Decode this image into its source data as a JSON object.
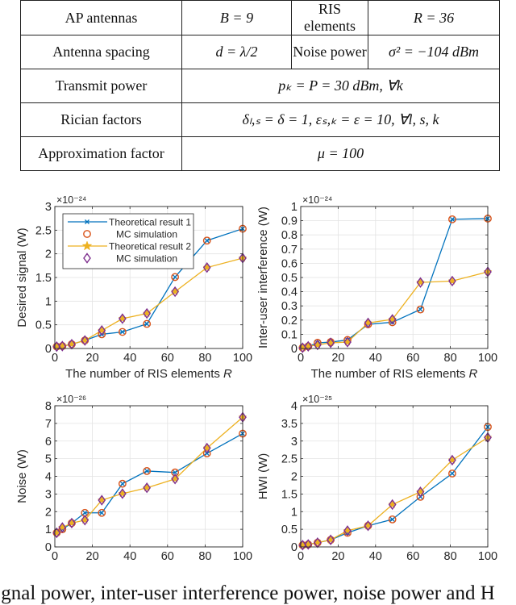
{
  "table": {
    "rows": [
      {
        "cells": [
          "AP antennas",
          "B = 9",
          "RIS elements",
          "R = 36"
        ]
      },
      {
        "cells": [
          "Antenna spacing",
          "d = λ/2",
          "Noise power",
          "σ² = −104 dBm"
        ]
      },
      {
        "cells": [
          "Transmit power",
          "pₖ = P = 30 dBm, ∀k"
        ]
      },
      {
        "cells": [
          "Rician factors",
          "δₗ,ₛ = δ = 1, εₛ,ₖ = ε = 10, ∀l, s, k"
        ]
      },
      {
        "cells": [
          "Approximation factor",
          "μ = 100"
        ]
      }
    ]
  },
  "caption": "gnal power, inter-user interference power, noise power and H",
  "colors": {
    "series1": "#0072BD",
    "mc1": "#D95319",
    "series2": "#EDB120",
    "mc2": "#7E2F8E"
  },
  "chart_data": [
    {
      "type": "line",
      "title": "",
      "xlabel": "The number of RIS elements R",
      "ylabel": "Desired signal (W)",
      "exponent": "×10⁻²⁴",
      "xlim": [
        0,
        100
      ],
      "ylim": [
        0,
        3
      ],
      "xticks": [
        0,
        20,
        40,
        60,
        80,
        100
      ],
      "yticks": [
        0,
        0.5,
        1,
        1.5,
        2,
        2.5,
        3
      ],
      "ytick_labels": [
        "0",
        "0.5",
        "1",
        "1.5",
        "2",
        "2.5",
        "3"
      ],
      "grid": true,
      "legend": {
        "placement": "top-left",
        "entries": [
          "Theoretical result 1",
          "MC simulation",
          "Theoretical result 2",
          "MC simulation"
        ]
      },
      "x": [
        1,
        4,
        9,
        16,
        25,
        36,
        49,
        64,
        81,
        100
      ],
      "series": [
        {
          "name": "Theoretical result 1",
          "values": [
            0.04,
            0.05,
            0.09,
            0.17,
            0.3,
            0.35,
            0.52,
            1.51,
            2.28,
            2.53
          ]
        },
        {
          "name": "MC simulation (1)",
          "values": [
            0.04,
            0.05,
            0.09,
            0.17,
            0.3,
            0.35,
            0.52,
            1.51,
            2.28,
            2.53
          ]
        },
        {
          "name": "Theoretical result 2",
          "values": [
            0.04,
            0.05,
            0.09,
            0.17,
            0.38,
            0.63,
            0.74,
            1.2,
            1.71,
            1.91
          ]
        },
        {
          "name": "MC simulation (2)",
          "values": [
            0.04,
            0.05,
            0.09,
            0.17,
            0.38,
            0.63,
            0.74,
            1.2,
            1.71,
            1.91
          ]
        }
      ]
    },
    {
      "type": "line",
      "title": "",
      "xlabel": "The number of RIS elements R",
      "ylabel": "Inter-user interference (W)",
      "exponent": "×10⁻²⁴",
      "xlim": [
        0,
        100
      ],
      "ylim": [
        0,
        1
      ],
      "xticks": [
        0,
        20,
        40,
        60,
        80,
        100
      ],
      "yticks": [
        0,
        0.1,
        0.2,
        0.3,
        0.4,
        0.5,
        0.6,
        0.7,
        0.8,
        0.9,
        1
      ],
      "ytick_labels": [
        "0",
        "0.1",
        "0.2",
        "0.3",
        "0.4",
        "0.5",
        "0.6",
        "0.7",
        "0.8",
        "0.9",
        "1"
      ],
      "grid": true,
      "x": [
        1,
        4,
        9,
        16,
        25,
        36,
        49,
        64,
        81,
        100
      ],
      "series": [
        {
          "name": "Theoretical result 1",
          "values": [
            0.005,
            0.015,
            0.04,
            0.045,
            0.06,
            0.17,
            0.185,
            0.275,
            0.91,
            0.915
          ]
        },
        {
          "name": "MC simulation (1)",
          "values": [
            0.005,
            0.015,
            0.04,
            0.045,
            0.06,
            0.17,
            0.185,
            0.275,
            0.91,
            0.915
          ]
        },
        {
          "name": "Theoretical result 2",
          "values": [
            0.005,
            0.015,
            0.025,
            0.04,
            0.045,
            0.18,
            0.205,
            0.465,
            0.475,
            0.54
          ]
        },
        {
          "name": "MC simulation (2)",
          "values": [
            0.005,
            0.015,
            0.025,
            0.04,
            0.045,
            0.18,
            0.205,
            0.465,
            0.475,
            0.54
          ]
        }
      ]
    },
    {
      "type": "line",
      "title": "",
      "xlabel": "The number of RIS elements R",
      "ylabel": "Noise (W)",
      "exponent": "×10⁻²⁶",
      "xlim": [
        0,
        100
      ],
      "ylim": [
        0,
        8
      ],
      "xticks": [
        0,
        20,
        40,
        60,
        80,
        100
      ],
      "yticks": [
        0,
        1,
        2,
        3,
        4,
        5,
        6,
        7,
        8
      ],
      "ytick_labels": [
        "0",
        "1",
        "2",
        "3",
        "4",
        "5",
        "6",
        "7",
        "8"
      ],
      "grid": true,
      "x": [
        1,
        4,
        9,
        16,
        25,
        36,
        49,
        64,
        81,
        100
      ],
      "series": [
        {
          "name": "Theoretical result 1",
          "values": [
            0.8,
            1.0,
            1.35,
            1.93,
            1.93,
            3.58,
            4.3,
            4.22,
            5.3,
            6.42
          ]
        },
        {
          "name": "MC simulation (1)",
          "values": [
            0.8,
            1.0,
            1.35,
            1.93,
            1.93,
            3.58,
            4.3,
            4.22,
            5.3,
            6.42
          ]
        },
        {
          "name": "Theoretical result 2",
          "values": [
            0.8,
            1.1,
            1.35,
            1.52,
            2.65,
            3.02,
            3.35,
            3.85,
            5.6,
            7.35
          ]
        },
        {
          "name": "MC simulation (2)",
          "values": [
            0.8,
            1.1,
            1.35,
            1.52,
            2.65,
            3.02,
            3.35,
            3.85,
            5.6,
            7.35
          ]
        }
      ]
    },
    {
      "type": "line",
      "title": "",
      "xlabel": "The number of RIS elements R",
      "ylabel": "HWI (W)",
      "exponent": "×10⁻²⁵",
      "xlim": [
        0,
        100
      ],
      "ylim": [
        0,
        4
      ],
      "xticks": [
        0,
        20,
        40,
        60,
        80,
        100
      ],
      "yticks": [
        0,
        0.5,
        1,
        1.5,
        2,
        2.5,
        3,
        3.5,
        4
      ],
      "ytick_labels": [
        "0",
        "0.5",
        "1",
        "1.5",
        "2",
        "2.5",
        "3",
        "3.5",
        "4"
      ],
      "grid": true,
      "x": [
        1,
        4,
        9,
        16,
        25,
        36,
        49,
        64,
        81,
        100
      ],
      "series": [
        {
          "name": "Theoretical result 1",
          "values": [
            0.05,
            0.07,
            0.12,
            0.2,
            0.4,
            0.6,
            0.78,
            1.42,
            2.08,
            3.4
          ]
        },
        {
          "name": "MC simulation (1)",
          "values": [
            0.05,
            0.07,
            0.12,
            0.2,
            0.4,
            0.6,
            0.78,
            1.42,
            2.08,
            3.4
          ]
        },
        {
          "name": "Theoretical result 2",
          "values": [
            0.05,
            0.07,
            0.12,
            0.2,
            0.46,
            0.6,
            1.2,
            1.56,
            2.46,
            3.1
          ]
        },
        {
          "name": "MC simulation (2)",
          "values": [
            0.05,
            0.07,
            0.12,
            0.2,
            0.46,
            0.6,
            1.2,
            1.56,
            2.46,
            3.1
          ]
        }
      ]
    }
  ]
}
